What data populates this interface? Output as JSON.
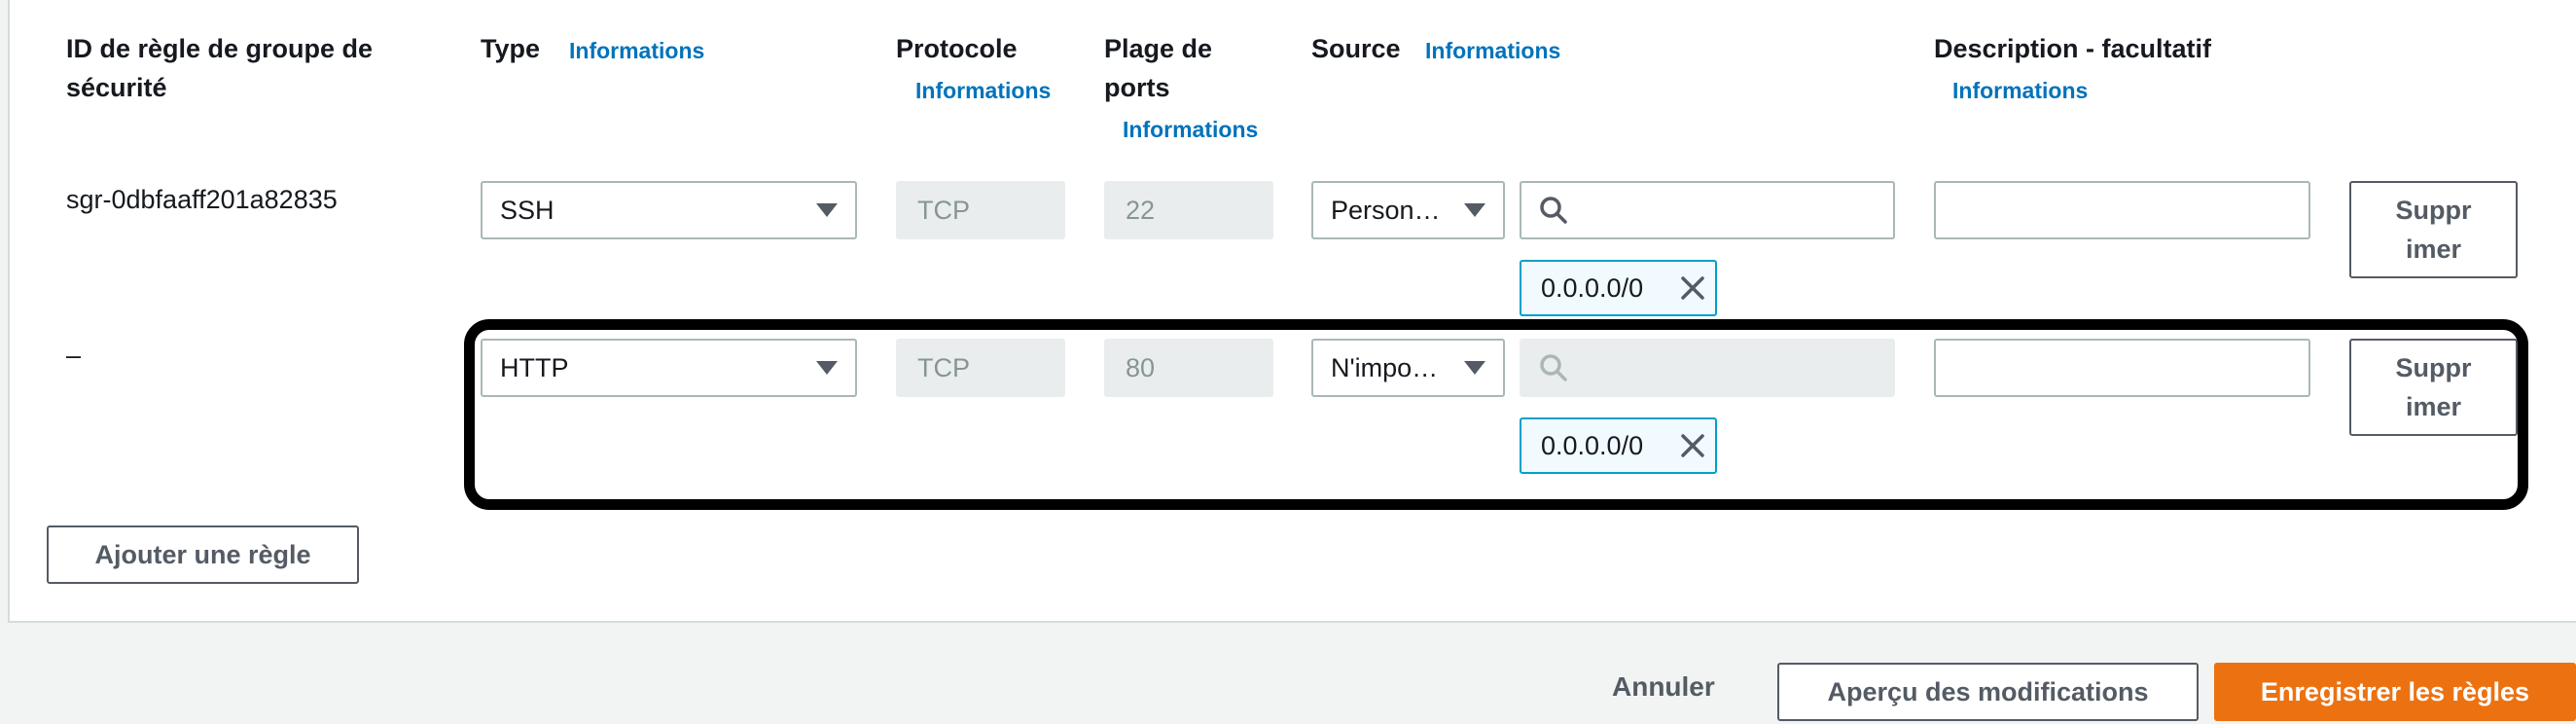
{
  "table": {
    "headers": {
      "id": "ID de règle de groupe de sécurité",
      "type": "Type",
      "protocol": "Protocole",
      "port_range": "Plage de ports",
      "source": "Source",
      "description": "Description - facultatif"
    },
    "info_label": "Informations",
    "rows": [
      {
        "id": "sgr-0dbfaaff201a82835",
        "type": "SSH",
        "protocol": "TCP",
        "port": "22",
        "source": "Person…",
        "search_value": "",
        "cidr": "0.0.0.0/0",
        "description": "",
        "delete_label": "Suppr imer"
      },
      {
        "id": "–",
        "type": "HTTP",
        "protocol": "TCP",
        "port": "80",
        "source": "N'impo…",
        "search_value": "",
        "cidr": "0.0.0.0/0",
        "description": "",
        "delete_label": "Suppr imer"
      }
    ]
  },
  "add_rule_label": "Ajouter une règle",
  "footer": {
    "cancel": "Annuler",
    "preview": "Aperçu des modifications",
    "save": "Enregistrer les règles"
  },
  "colors": {
    "info_link": "#0073bb",
    "primary_button": "#ec7211",
    "token_border": "#00a1c9"
  }
}
